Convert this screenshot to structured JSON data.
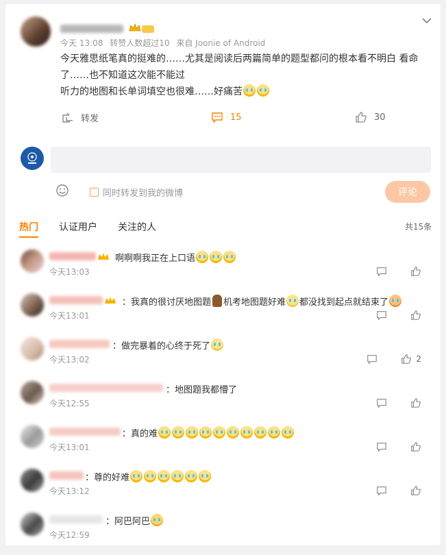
{
  "post": {
    "time": "今天 13:08",
    "repost_note": "转赞人数超过10",
    "source": "来自 Joonie of Android",
    "lines": [
      "今天雅思纸笔真的挺难的……尤其是阅读后两篇简单的题型都问的根本看不明白 看命",
      "了……也不知道这次能不能过",
      "听力的地图和长单词填空也很难……好痛苦"
    ],
    "actions": {
      "repost": "转发",
      "comments": "15",
      "likes": "30"
    }
  },
  "reply_box": {
    "checkbox_label": "同时转发到我的微博",
    "submit": "评论"
  },
  "tabs": {
    "hot": "热门",
    "verified": "认证用户",
    "following": "关注的人",
    "total": "共15条"
  },
  "comments": [
    {
      "text": "啊啊啊我正在上口语",
      "time": "今天13:03",
      "likes": "",
      "emoji_count": 3
    },
    {
      "text": "我真的很讨厌地图题",
      "text2": "机考地图题好难",
      "text3": "都没找到起点就结束了",
      "time": "今天13:01",
      "likes": ""
    },
    {
      "text": "做完暴着的心终于死了",
      "time": "今天13:02",
      "likes": "2"
    },
    {
      "text": "地图题我都懵了",
      "time": "今天12:55",
      "likes": ""
    },
    {
      "text": "真的难",
      "time": "今天13:01",
      "likes": "",
      "emoji_count": 10
    },
    {
      "text": "尊的好难",
      "time": "今天13:12",
      "likes": "",
      "emoji_count": 6
    },
    {
      "text": "阿巴阿巴",
      "time": "今天12:59",
      "likes": ""
    }
  ]
}
